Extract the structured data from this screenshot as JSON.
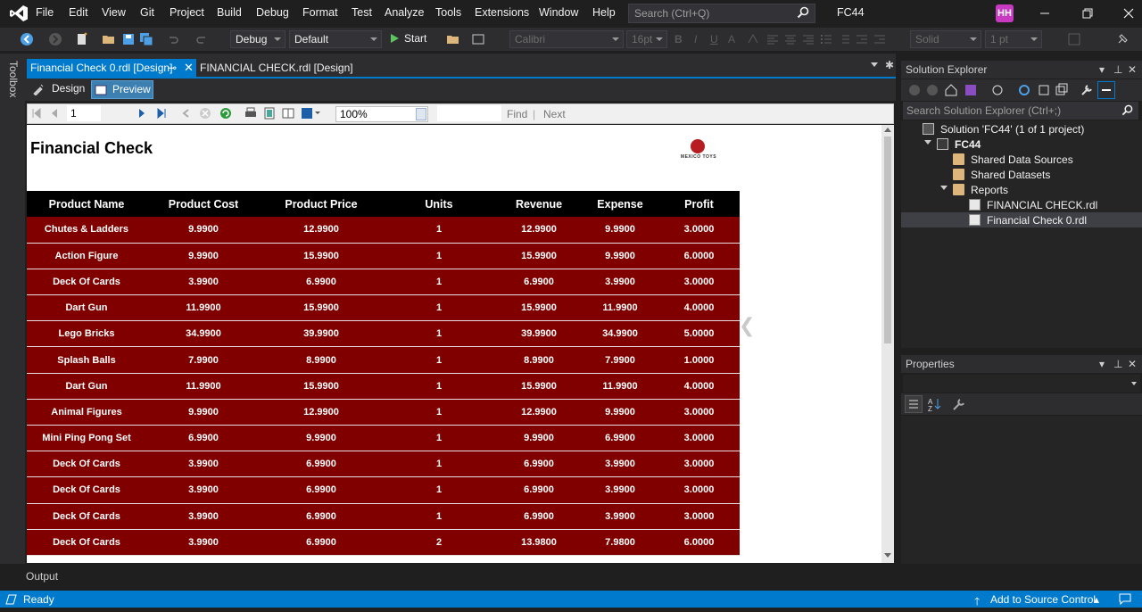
{
  "menu": [
    "File",
    "Edit",
    "View",
    "Git",
    "Project",
    "Build",
    "Debug",
    "Format",
    "Test",
    "Analyze",
    "Tools",
    "Extensions",
    "Window",
    "Help"
  ],
  "search": {
    "placeholder": "Search (Ctrl+Q)"
  },
  "solution_short": "FC44",
  "user_initials": "HH",
  "toolbar": {
    "config": "Debug",
    "platform": "Default",
    "start_label": "Start",
    "font": "Calibri",
    "font_size": "16pt",
    "line_style": "Solid",
    "line_width": "1 pt"
  },
  "toolbox_label": "Toolbox",
  "tabs": [
    {
      "label": "Financial Check 0.rdl [Design]"
    },
    {
      "label": "FINANCIAL CHECK.rdl [Design]"
    }
  ],
  "view_tabs": {
    "design": "Design",
    "preview": "Preview"
  },
  "report_toolbar": {
    "page": "1",
    "zoom": "100%",
    "find": "Find",
    "separator": "|",
    "next": "Next"
  },
  "report": {
    "title": "Financial Check",
    "logo_text": "MEXICO TOYS",
    "columns": [
      "Product Name",
      "Product Cost",
      "Product Price",
      "Units",
      "Revenue",
      "Expense",
      "Profit"
    ],
    "rows": [
      [
        "Chutes & Ladders",
        "9.9900",
        "12.9900",
        "1",
        "12.9900",
        "9.9900",
        "3.0000"
      ],
      [
        "Action Figure",
        "9.9900",
        "15.9900",
        "1",
        "15.9900",
        "9.9900",
        "6.0000"
      ],
      [
        "Deck Of Cards",
        "3.9900",
        "6.9900",
        "1",
        "6.9900",
        "3.9900",
        "3.0000"
      ],
      [
        "Dart Gun",
        "11.9900",
        "15.9900",
        "1",
        "15.9900",
        "11.9900",
        "4.0000"
      ],
      [
        "Lego Bricks",
        "34.9900",
        "39.9900",
        "1",
        "39.9900",
        "34.9900",
        "5.0000"
      ],
      [
        "Splash Balls",
        "7.9900",
        "8.9900",
        "1",
        "8.9900",
        "7.9900",
        "1.0000"
      ],
      [
        "Dart Gun",
        "11.9900",
        "15.9900",
        "1",
        "15.9900",
        "11.9900",
        "4.0000"
      ],
      [
        "Animal Figures",
        "9.9900",
        "12.9900",
        "1",
        "12.9900",
        "9.9900",
        "3.0000"
      ],
      [
        "Mini Ping Pong Set",
        "6.9900",
        "9.9900",
        "1",
        "9.9900",
        "6.9900",
        "3.0000"
      ],
      [
        "Deck Of Cards",
        "3.9900",
        "6.9900",
        "1",
        "6.9900",
        "3.9900",
        "3.0000"
      ],
      [
        "Deck Of Cards",
        "3.9900",
        "6.9900",
        "1",
        "6.9900",
        "3.9900",
        "3.0000"
      ],
      [
        "Deck Of Cards",
        "3.9900",
        "6.9900",
        "1",
        "6.9900",
        "3.9900",
        "3.0000"
      ],
      [
        "Deck Of Cards",
        "3.9900",
        "6.9900",
        "2",
        "13.9800",
        "7.9800",
        "6.0000"
      ]
    ]
  },
  "solution_explorer": {
    "title": "Solution Explorer",
    "search_placeholder": "Search Solution Explorer (Ctrl+;)",
    "tree": [
      {
        "label": "Solution 'FC44' (1 of 1 project)",
        "indent": 0,
        "icon": "solution-icon",
        "expand": false
      },
      {
        "label": "FC44",
        "indent": 1,
        "icon": "project-icon",
        "expand": true
      },
      {
        "label": "Shared Data Sources",
        "indent": 2,
        "icon": "folder-icon",
        "expand": false
      },
      {
        "label": "Shared Datasets",
        "indent": 2,
        "icon": "folder-icon",
        "expand": false
      },
      {
        "label": "Reports",
        "indent": 2,
        "icon": "folder-icon",
        "expand": true
      },
      {
        "label": "FINANCIAL CHECK.rdl",
        "indent": 3,
        "icon": "report-file-icon",
        "expand": false
      },
      {
        "label": "Financial Check 0.rdl",
        "indent": 3,
        "icon": "report-file-icon",
        "expand": false,
        "selected": true
      }
    ]
  },
  "properties": {
    "title": "Properties"
  },
  "output_label": "Output",
  "status": {
    "text": "Ready",
    "source_control": "Add to Source Control"
  },
  "colors": {
    "accent": "#007acc",
    "table_row": "#800000",
    "table_header": "#000000"
  }
}
